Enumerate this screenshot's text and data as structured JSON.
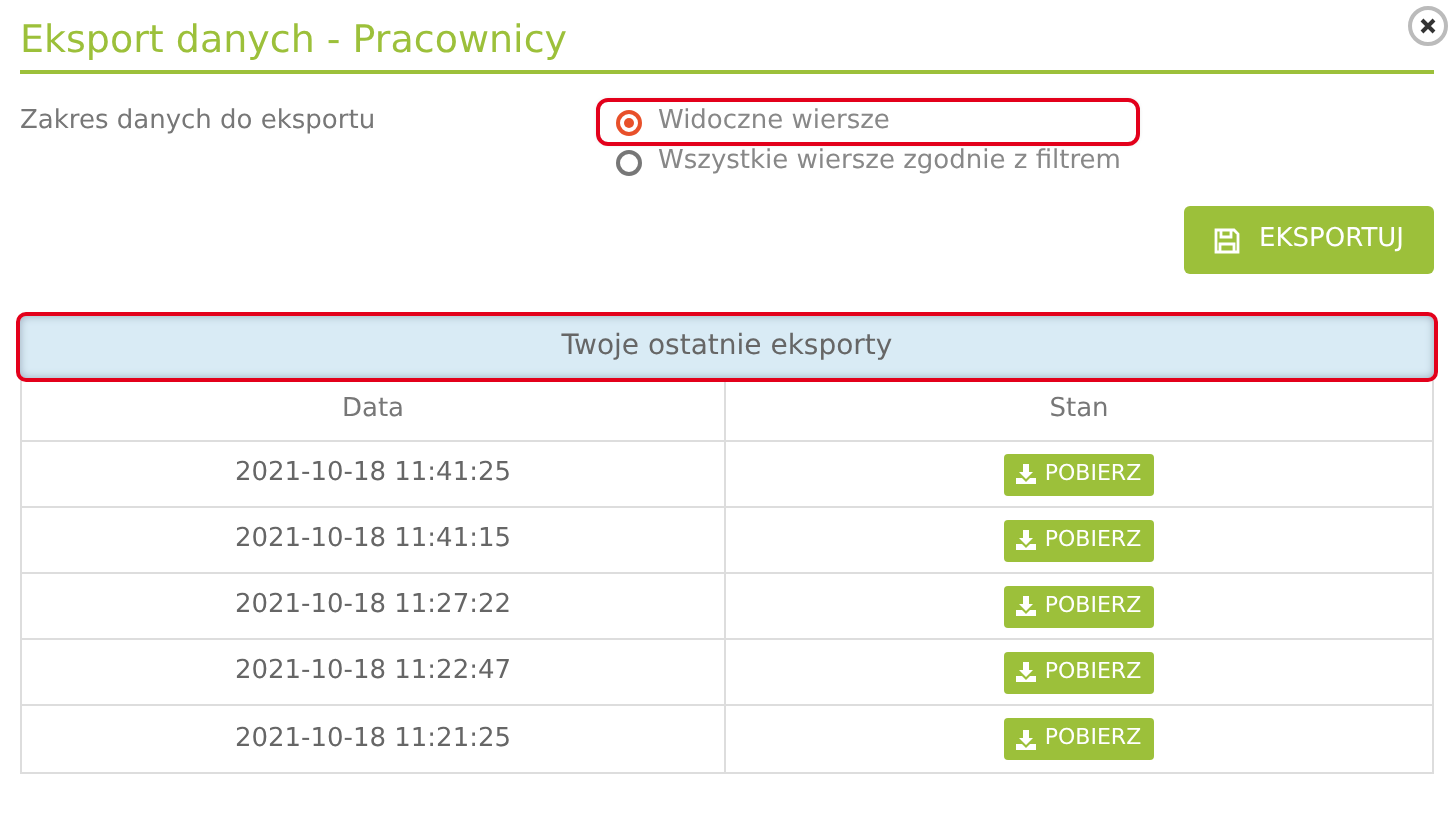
{
  "dialog": {
    "title": "Eksport danych - Pracownicy"
  },
  "range": {
    "label": "Zakres danych do eksportu",
    "options": [
      {
        "label": "Widoczne wiersze",
        "selected": true,
        "highlighted": true
      },
      {
        "label": "Wszystkie wiersze zgodnie z filtrem",
        "selected": false,
        "highlighted": false
      }
    ]
  },
  "export_button": "EKSPORTUJ",
  "recent": {
    "title": "Twoje ostatnie eksporty",
    "highlighted": true,
    "columns": [
      "Data",
      "Stan"
    ],
    "rows": [
      {
        "date": "2021-10-18 11:41:25",
        "action": "POBIERZ"
      },
      {
        "date": "2021-10-18 11:41:15",
        "action": "POBIERZ"
      },
      {
        "date": "2021-10-18 11:27:22",
        "action": "POBIERZ"
      },
      {
        "date": "2021-10-18 11:22:47",
        "action": "POBIERZ"
      },
      {
        "date": "2021-10-18 11:21:25",
        "action": "POBIERZ"
      }
    ]
  }
}
